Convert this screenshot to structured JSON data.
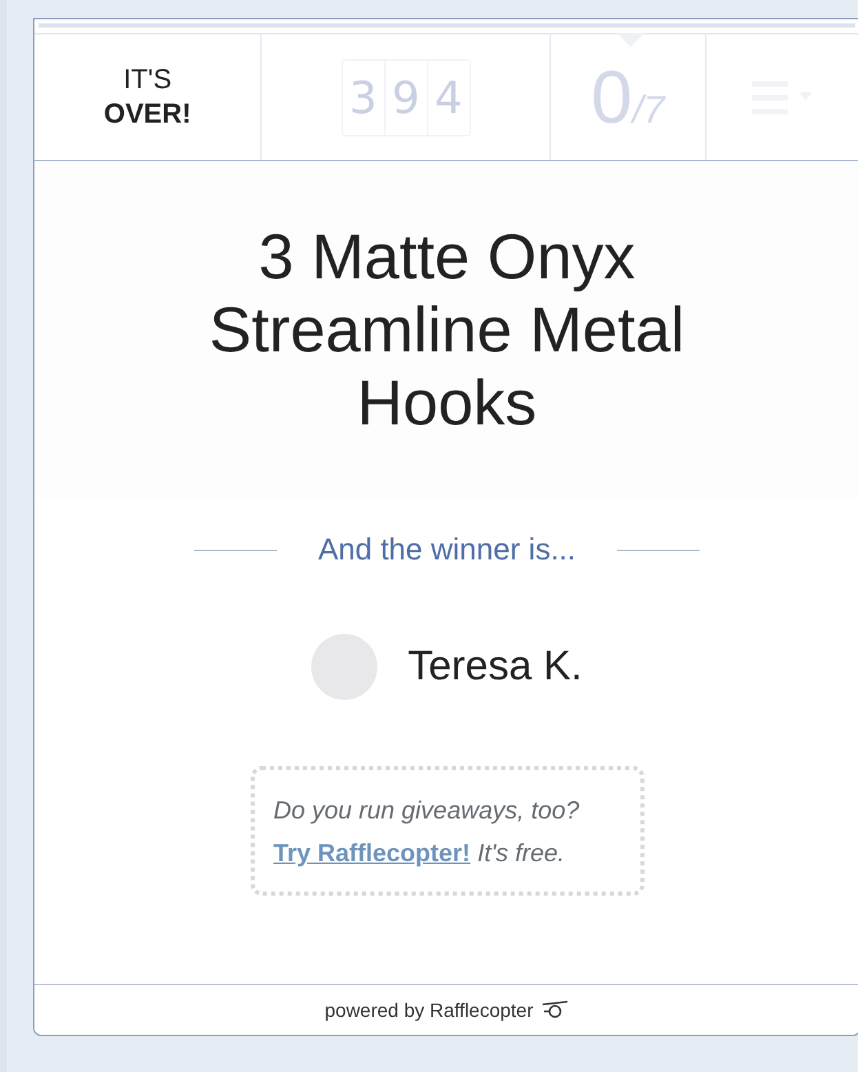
{
  "header": {
    "status_line1": "IT'S",
    "status_line2": "OVER!",
    "counter_digits": [
      "3",
      "9",
      "4"
    ],
    "entries_count": "0",
    "entries_total": "/7"
  },
  "title": "3 Matte Onyx Streamline Metal Hooks",
  "winner_heading": "And the winner is...",
  "winner": {
    "name": "Teresa K."
  },
  "promo": {
    "question": "Do you run giveaways, too?",
    "link": "Try Rafflecopter!",
    "note": "It's free."
  },
  "footer": "powered by Rafflecopter"
}
